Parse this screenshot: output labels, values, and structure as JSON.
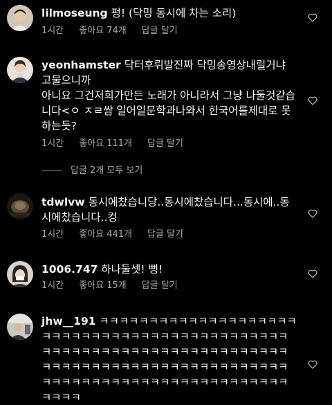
{
  "comments": [
    {
      "username": "lilmoseung",
      "text": "펑! (닥밍 동시에 차는 소리)",
      "time": "1시간",
      "likes": "좋아요 74개",
      "reply": "답글 달기"
    },
    {
      "username": "yeonhamster",
      "text": "닥터후뤼발진짜 닥밍송영상내릴거냐 고물으니까\n아니요 그건저희가만든 노래가 아니라서 그냥 나둘것같습니다<ㅇ ㅈㄹ쌈 일어일문학과나와서 한국어를제대로 못하는듯?",
      "time": "1시간",
      "likes": "좋아요 111개",
      "reply": "답글 달기"
    },
    {
      "username": "tdwlvw",
      "text": "동시에찼습니당..동시에찼습니다...동시에..동시에찼습니다..컹",
      "time": "1시간",
      "likes": "좋아요 441개",
      "reply": "답글 달기"
    },
    {
      "username": "1006.747",
      "text": "하나둘셋! 뻥!",
      "time": "1시간",
      "likes": "좋아요 15개",
      "reply": "답글 달기"
    },
    {
      "username": "jhw__191",
      "text": "ㅋㅋㅋㅋㅋㅋㅋㅋㅋㅋㅋㅋㅋㅋㅋㅋㅋㅋㅋㅋㅋㅋㅋㅋㅋㅋㅋㅋㅋㅋㅋㅋㅋㅋㅋㅋㅋㅋㅋㅋㅋㅋㅋㅋㅋㅋㅋㅋㅋㅋㅋㅋㅋㅋㅋㅋㅋㅋㅋㅋㅋㅋㅋㅋㅋㅋㅋㅋㅋㅋㅋㅋㅋㅋㅋㅋㅋㅋㅋㅋㅋㅋㅋㅋㅋㅋㅋㅋㅋㅋㅋㅋㅋㅋㅋㅋㅋㅋㅋㅋㅋㅋㅋㅋㅋㅋㅋㅋㅋㅋㅋㅋㅋㅋㅋㅋㅋㅋㅋㅋㅋㅋㅋㅋ"
    }
  ],
  "view_replies": "답글 2개 모두 보기",
  "icons": {
    "like": "heart-outline-icon"
  },
  "colors": {
    "background": "#000000",
    "text": "#f5f5f5",
    "secondary": "#a8a8a8"
  }
}
